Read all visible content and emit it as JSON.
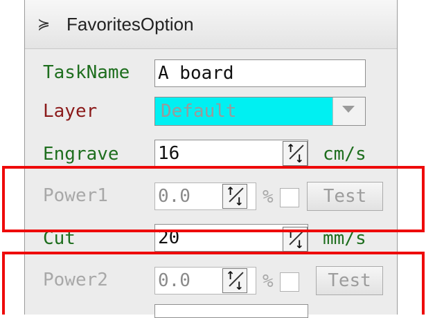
{
  "header": {
    "icon": "double-chevron-down-icon",
    "glyph": "≽",
    "title": "FavoritesOption"
  },
  "rows": {
    "taskname": {
      "label": "TaskName",
      "value": "A board"
    },
    "layer": {
      "label": "Layer",
      "value": "Default"
    },
    "engrave": {
      "label": "Engrave",
      "value": "16",
      "unit": "cm/s"
    },
    "power1": {
      "label": "Power1",
      "value": "0.0",
      "unit": "%",
      "button": "Test",
      "checked": false
    },
    "cut": {
      "label": "Cut",
      "value": "20",
      "unit": "mm/s"
    },
    "power2": {
      "label": "Power2",
      "value": "0.0",
      "unit": "%",
      "button": "Test",
      "checked": false
    }
  },
  "colors": {
    "highlight": "#ee0a0a",
    "layer_bg": "#00f0f2",
    "label_green": "#1e6e1e",
    "label_red": "#8b1a1a"
  }
}
